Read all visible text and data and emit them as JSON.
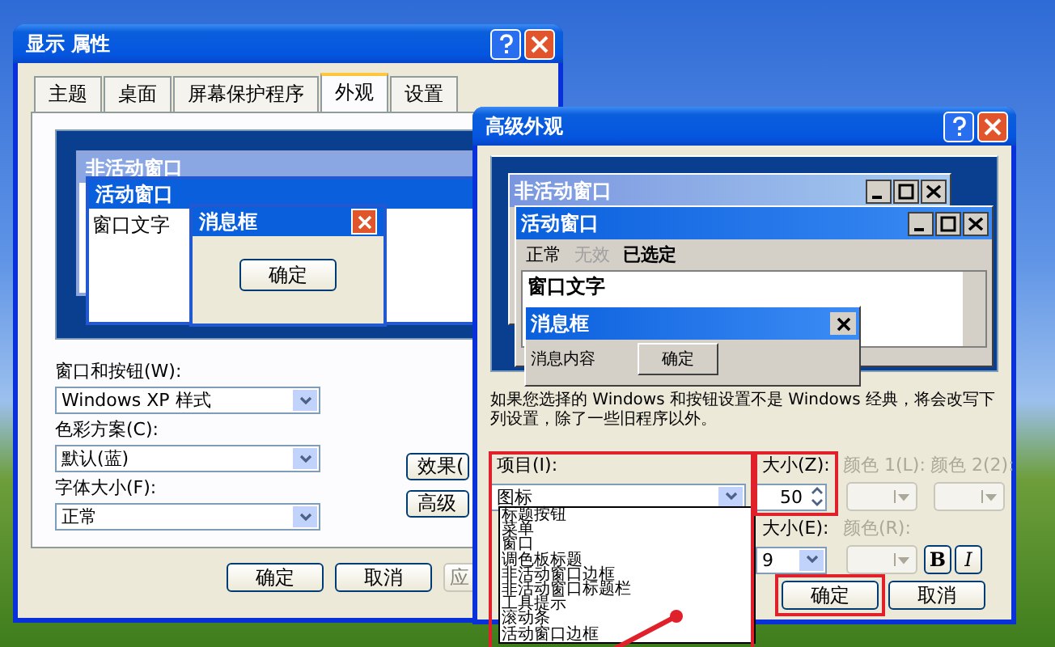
{
  "display_properties": {
    "title": "显示 属性",
    "tabs": [
      {
        "label": "主题",
        "selected": false
      },
      {
        "label": "桌面",
        "selected": false
      },
      {
        "label": "屏幕保护程序",
        "selected": false
      },
      {
        "label": "外观",
        "selected": true
      },
      {
        "label": "设置",
        "selected": false
      }
    ],
    "preview": {
      "inactive_title": "非活动窗口",
      "active_title": "活动窗口",
      "window_text": "窗口文字",
      "message_title": "消息框",
      "ok_button": "确定"
    },
    "fields": [
      {
        "label": "窗口和按钮(W):",
        "value": "Windows XP 样式"
      },
      {
        "label": "色彩方案(C):",
        "value": "默认(蓝)"
      },
      {
        "label": "字体大小(F):",
        "value": "正常"
      }
    ],
    "side_buttons": [
      "效果(",
      "高级"
    ],
    "buttons": [
      {
        "label": "确定",
        "disabled": false
      },
      {
        "label": "取消",
        "disabled": false
      },
      {
        "label": "应",
        "disabled": true
      }
    ]
  },
  "advanced_appearance": {
    "title": "高级外观",
    "preview": {
      "inactive_title": "非活动窗口",
      "active_title": "活动窗口",
      "menu": [
        {
          "label": "正常",
          "kind": "normal"
        },
        {
          "label": "无效",
          "kind": "disabled"
        },
        {
          "label": "已选定",
          "kind": "selected"
        }
      ],
      "window_text": "窗口文字",
      "message_title": "消息框",
      "message_text": "消息内容",
      "ok_button": "确定"
    },
    "notice": "如果您选择的 Windows 和按钮设置不是 Windows 经典，将会改写下列设置，除了一些旧程序以外。",
    "item": {
      "label": "项目(I):",
      "value": "图标",
      "options": [
        "标题按钮",
        "菜单",
        "窗口",
        "调色板标题",
        "非活动窗口边框",
        "非活动窗口标题栏",
        "工具提示",
        "滚动条",
        "活动窗口边框"
      ]
    },
    "size": {
      "label": "大小(Z):",
      "value": "50"
    },
    "color_1": {
      "label": "颜色 1(L):",
      "disabled": true
    },
    "color_2": {
      "label": "颜色 2(2):",
      "disabled": true
    },
    "font_size": {
      "label": "大小(E):",
      "value": "9"
    },
    "font_color": {
      "label": "颜色(R):",
      "disabled": true
    },
    "bold_button": "B",
    "italic_button": "I",
    "buttons": [
      "确定",
      "取消"
    ]
  }
}
